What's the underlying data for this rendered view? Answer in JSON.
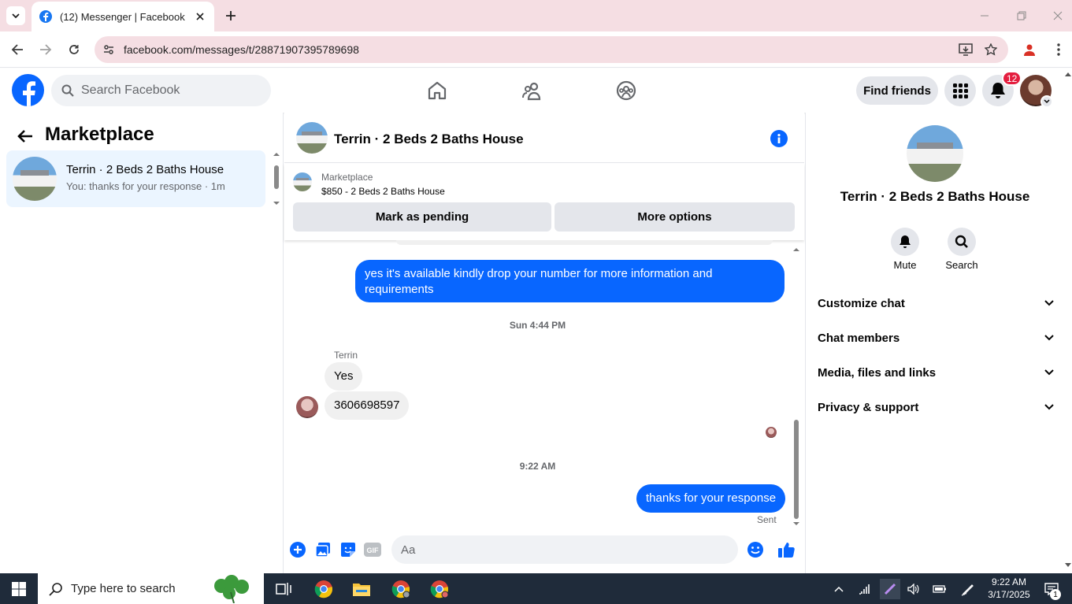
{
  "browser": {
    "tab_title": "(12) Messenger | Facebook",
    "url": "facebook.com/messages/t/28871907395789698"
  },
  "fb_header": {
    "search_placeholder": "Search Facebook",
    "find_friends": "Find friends",
    "notification_count": "12"
  },
  "left_panel": {
    "title": "Marketplace",
    "conversations": [
      {
        "name": "Terrin · 2 Beds 2 Baths House",
        "preview": "You: thanks for your response · 1m"
      }
    ]
  },
  "chat": {
    "title": "Terrin · 2 Beds 2 Baths House",
    "marketplace_label": "Marketplace",
    "listing": "$850 - 2 Beds 2 Baths House",
    "mark_pending": "Mark as pending",
    "more_options": "More options",
    "messages": {
      "out1": "yes it's available kindly drop your number for more information and requirements",
      "ts1": "Sun 4:44 PM",
      "sender": "Terrin",
      "in1": "Yes",
      "in2": "3606698597",
      "ts2": "9:22 AM",
      "out2": "thanks for your response",
      "status": "Sent"
    },
    "composer_placeholder": "Aa"
  },
  "right_panel": {
    "name": "Terrin · 2 Beds 2 Baths House",
    "actions": [
      {
        "label": "Mute",
        "icon": "bell-icon"
      },
      {
        "label": "Search",
        "icon": "search-icon"
      }
    ],
    "sections": [
      "Customize chat",
      "Chat members",
      "Media, files and links",
      "Privacy & support"
    ]
  },
  "taskbar": {
    "search_placeholder": "Type here to search",
    "time": "9:22 AM",
    "date": "3/17/2025",
    "notification_count": "1"
  },
  "colors": {
    "accent": "#0866ff",
    "tab_bg": "#f5dee3",
    "selected_conv": "#ebf5ff",
    "taskbar": "#1f2b3a"
  }
}
